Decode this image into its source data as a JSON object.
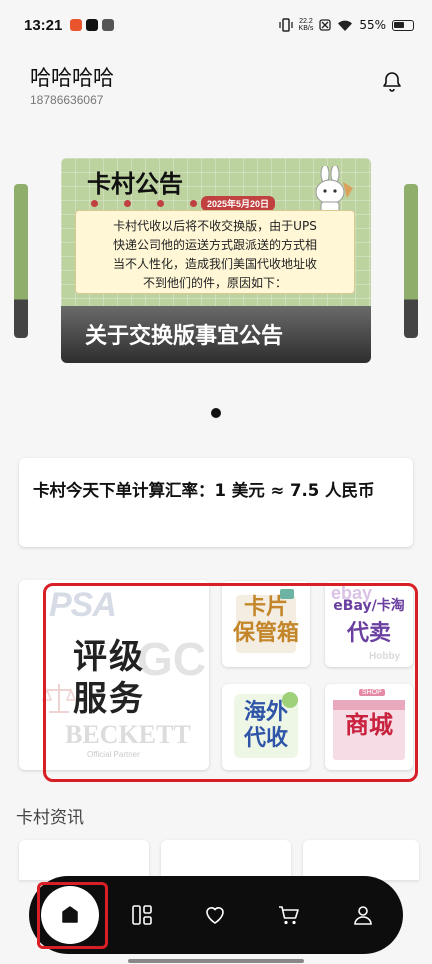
{
  "status_bar": {
    "time": "13:21",
    "net_speed_value": "22.2",
    "net_speed_unit": "KB/s",
    "battery": "55%"
  },
  "user": {
    "name": "哈哈哈哈",
    "phone": "18786636067"
  },
  "banner": {
    "title": "卡村公告",
    "date": "2025年5月20日",
    "note_lines": [
      "卡村代收以后将不收交换版，由于UPS",
      "快递公司他的运送方式跟派送的方式相",
      "当不人性化，造成我们美国代收地址收",
      "不到他们的件，原因如下："
    ],
    "caption": "关于交换版事宜公告",
    "carousel_page": 1
  },
  "rate_card": {
    "text": "卡村今天下单计算汇率：1 美元 ≈ 7.5 人民币"
  },
  "services": {
    "grading": {
      "title_line1": "评级",
      "title_line2": "服务",
      "logo_psa": "PSA",
      "logo_bgs": "GC",
      "logo_beckett": "BECKETT",
      "logo_beckett_sub": "Official Partner"
    },
    "card_storage": {
      "title_line1": "卡片",
      "title_line2": "保管箱"
    },
    "ebay": {
      "label": "eBay/卡淘",
      "title": "代卖",
      "deco_ebay": "ebay",
      "deco_hobby": "Hobby"
    },
    "overseas": {
      "title_line1": "海外",
      "title_line2": "代收"
    },
    "mall": {
      "title": "商城",
      "deco_shop": "SHOP"
    }
  },
  "news": {
    "section_title": "卡村资讯"
  },
  "nav": {
    "items": [
      "home-icon",
      "grid-icon",
      "heart-icon",
      "cart-icon",
      "profile-icon"
    ]
  },
  "colors": {
    "accent_red": "#d81f26",
    "nav_bg": "#0d0d0d",
    "banner_green": "#bcd3a0"
  }
}
